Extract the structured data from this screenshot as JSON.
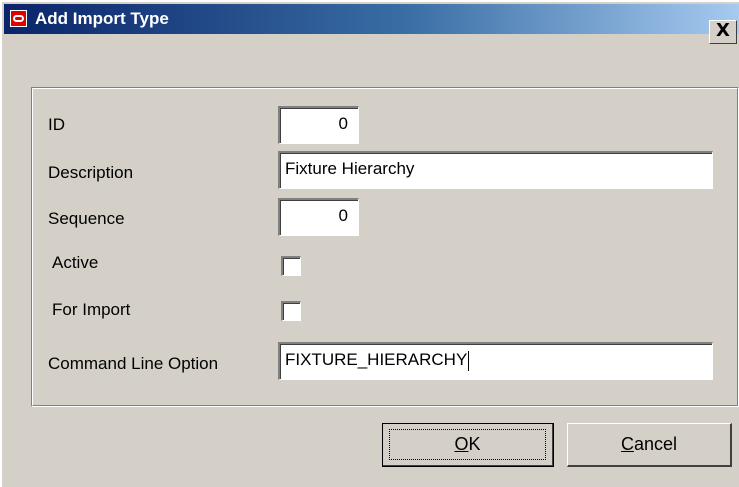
{
  "window": {
    "title": "Add Import Type",
    "close_label": "X"
  },
  "icons": {
    "app": "oracle-logo-icon",
    "close": "close-icon"
  },
  "form": {
    "id": {
      "label": "ID",
      "value": "0"
    },
    "description": {
      "label": "Description",
      "value": "Fixture Hierarchy"
    },
    "sequence": {
      "label": "Sequence",
      "value": "0"
    },
    "active": {
      "label": "Active",
      "checked": false
    },
    "for_import": {
      "label": "For Import",
      "checked": false
    },
    "command_line_option": {
      "label": "Command Line Option",
      "value": "FIXTURE_HIERARCHY"
    }
  },
  "buttons": {
    "ok": {
      "mnemonic": "O",
      "rest": "K"
    },
    "cancel": {
      "mnemonic": "C",
      "rest": "ancel"
    }
  },
  "colors": {
    "titlebar_start": "#0a246a",
    "titlebar_end": "#a6caf0",
    "dialog_bg": "#d4d0c8",
    "logo_red": "#e00000"
  }
}
